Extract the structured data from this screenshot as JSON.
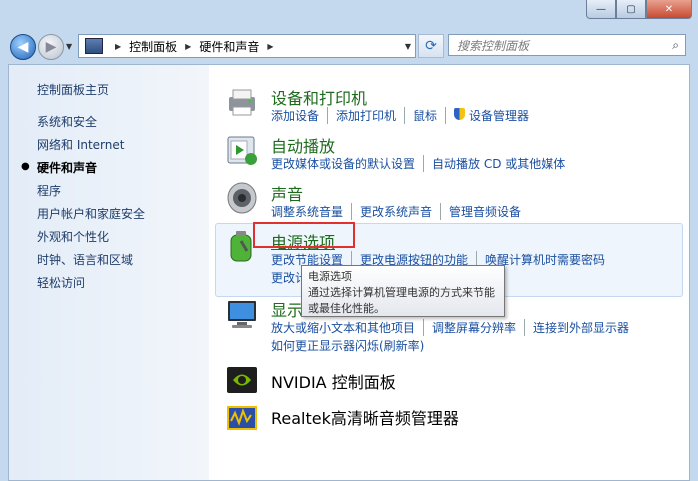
{
  "window": {
    "controls": {
      "minimize": "—",
      "maximize": "▢",
      "close": "✕"
    }
  },
  "nav": {
    "back_icon": "arrow-left-icon",
    "forward_icon": "arrow-right-icon",
    "breadcrumb": [
      "控制面板",
      "硬件和声音"
    ],
    "search_placeholder": "搜索控制面板"
  },
  "sidebar": {
    "items": [
      {
        "label": "控制面板主页",
        "active": false
      },
      {
        "label": "系统和安全",
        "active": false
      },
      {
        "label": "网络和 Internet",
        "active": false
      },
      {
        "label": "硬件和声音",
        "active": true
      },
      {
        "label": "程序",
        "active": false
      },
      {
        "label": "用户帐户和家庭安全",
        "active": false
      },
      {
        "label": "外观和个性化",
        "active": false
      },
      {
        "label": "时钟、语言和区域",
        "active": false
      },
      {
        "label": "轻松访问",
        "active": false
      }
    ]
  },
  "categories": [
    {
      "title": "设备和打印机",
      "icon": "printer-icon",
      "links": [
        "添加设备",
        "添加打印机",
        "鼠标",
        "设备管理器"
      ]
    },
    {
      "title": "自动播放",
      "icon": "autoplay-icon",
      "links": [
        "更改媒体或设备的默认设置",
        "自动播放 CD 或其他媒体"
      ]
    },
    {
      "title": "声音",
      "icon": "speaker-icon",
      "links": [
        "调整系统音量",
        "更改系统声音",
        "管理音频设备"
      ]
    },
    {
      "title": "电源选项",
      "icon": "battery-icon",
      "links": [
        "更改节能设置",
        "更改电源按钮的功能",
        "唤醒计算机时需要密码"
      ],
      "links2": "更改计"
    },
    {
      "title": "显示",
      "icon": "monitor-icon",
      "links": [
        "放大或缩小文本和其他项目",
        "调整屏幕分辨率",
        "连接到外部显示器"
      ],
      "links2": "如何更正显示器闪烁(刷新率)"
    },
    {
      "title": "NVIDIA 控制面板",
      "icon": "nvidia-icon",
      "links": []
    },
    {
      "title": "Realtek高清晰音频管理器",
      "icon": "realtek-icon",
      "links": []
    }
  ],
  "tooltip": {
    "title": "电源选项",
    "text": "通过选择计算机管理电源的方式来节能或最佳化性能。"
  }
}
